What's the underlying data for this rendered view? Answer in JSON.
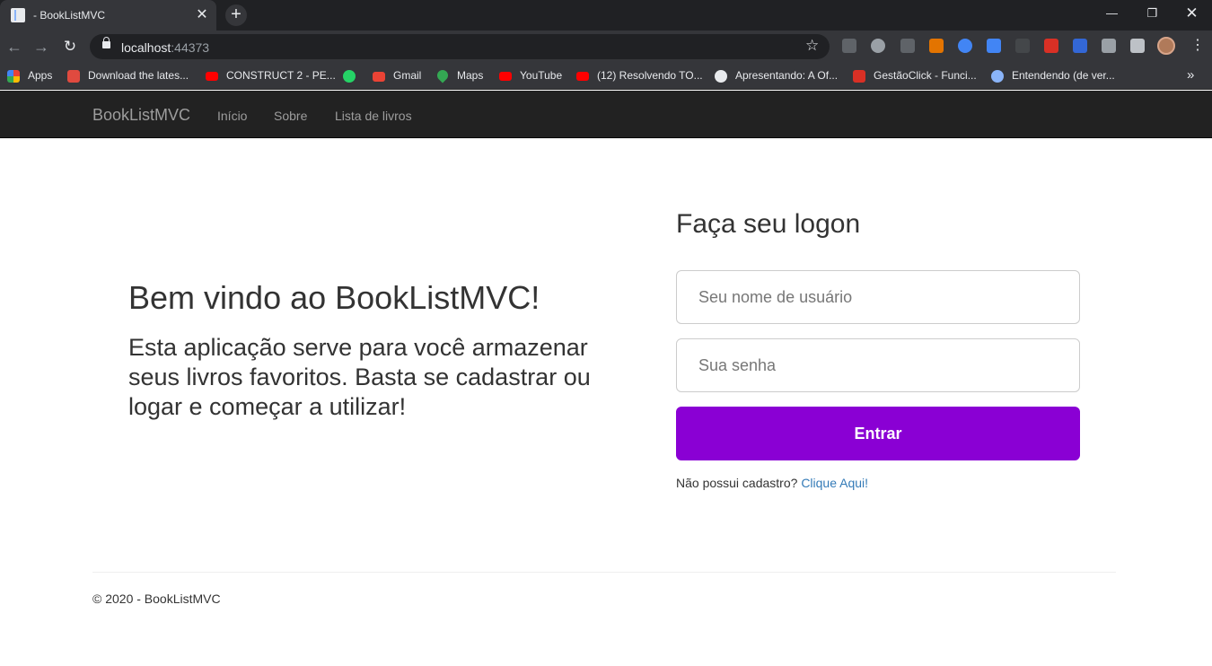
{
  "browser": {
    "tab_title": "- BookListMVC",
    "new_tab_icon": "+",
    "url_host": "localhost",
    "url_port": ":44373",
    "window_controls": {
      "minimize": "—",
      "maximize": "❐",
      "close": "✕"
    },
    "bookmarks": [
      {
        "label": "Apps",
        "icon": "apps-grid-icon",
        "color": "#ea4335"
      },
      {
        "label": "Download the lates...",
        "icon": "store-icon",
        "color": "#e04a3f"
      },
      {
        "label": "CONSTRUCT 2 - PE...",
        "icon": "youtube-icon",
        "color": "#ff0000"
      },
      {
        "label": "",
        "icon": "whatsapp-icon",
        "color": "#25d366"
      },
      {
        "label": "Gmail",
        "icon": "gmail-icon",
        "color": "#ea4335"
      },
      {
        "label": "Maps",
        "icon": "maps-icon",
        "color": "#34a853"
      },
      {
        "label": "YouTube",
        "icon": "youtube-icon",
        "color": "#ff0000"
      },
      {
        "label": "(12) Resolvendo TO...",
        "icon": "youtube-icon",
        "color": "#ff0000"
      },
      {
        "label": "Apresentando: A Of...",
        "icon": "globe-icon",
        "color": "#e8eaed"
      },
      {
        "label": "GestãoClick - Funci...",
        "icon": "gestaoclick-icon",
        "color": "#d93025"
      },
      {
        "label": "Entendendo (de ver...",
        "icon": "xamarin-icon",
        "color": "#8ab4f8"
      }
    ]
  },
  "nav": {
    "brand": "BookListMVC",
    "links": [
      "Início",
      "Sobre",
      "Lista de livros"
    ]
  },
  "welcome": {
    "title": "Bem vindo ao BookListMVC!",
    "text": "Esta aplicação serve para você armazenar seus livros favoritos. Basta se cadastrar ou logar e começar a utilizar!"
  },
  "login": {
    "title": "Faça seu logon",
    "username_placeholder": "Seu nome de usuário",
    "password_placeholder": "Sua senha",
    "submit_label": "Entrar",
    "signup_prompt": "Não possui cadastro?",
    "signup_link": "Clique Aqui!"
  },
  "footer": {
    "text": "© 2020 - BookListMVC"
  },
  "colors": {
    "primary_button": "#8a00d4",
    "navbar": "#222222",
    "link": "#337ab7"
  }
}
